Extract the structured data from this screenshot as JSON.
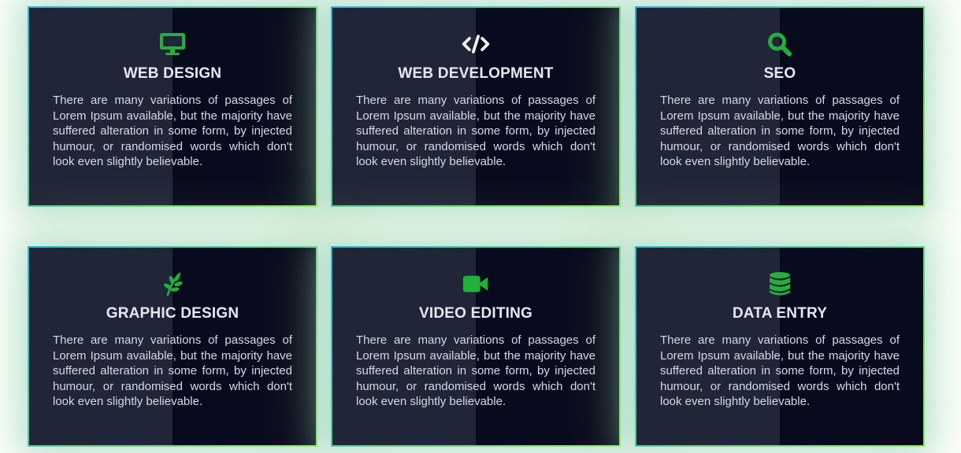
{
  "colors": {
    "accent": "#22b03a",
    "code_icon": "#f2f2f2",
    "card_left": "#202538",
    "card_right": "#080b1e",
    "border_from": "#27b4cf",
    "border_to": "#8fe84f"
  },
  "cards": [
    {
      "title": "WEB DESIGN",
      "icon": "monitor-icon",
      "text": "There are many variations of passages of Lorem Ipsum available, but the majority have suffered alteration in some form, by injected humour, or randomised words which don't look even slightly believable."
    },
    {
      "title": "WEB DEVELOPMENT",
      "icon": "code-icon",
      "text": "There are many variations of passages of Lorem Ipsum available, but the majority have suffered alteration in some form, by injected humour, or randomised words which don't look even slightly believable."
    },
    {
      "title": "SEO",
      "icon": "search-icon",
      "text": "There are many variations of passages of Lorem Ipsum available, but the majority have suffered alteration in some form, by injected humour, or randomised words which don't look even slightly believable."
    },
    {
      "title": "GRAPHIC DESIGN",
      "icon": "leaf-icon",
      "text": "There are many variations of passages of Lorem Ipsum available, but the majority have suffered alteration in some form, by injected humour, or randomised words which don't look even slightly believable."
    },
    {
      "title": "VIDEO EDITING",
      "icon": "video-camera-icon",
      "text": "There are many variations of passages of Lorem Ipsum available, but the majority have suffered alteration in some form, by injected humour, or randomised words which don't look even slightly believable."
    },
    {
      "title": "DATA ENTRY",
      "icon": "database-icon",
      "text": "There are many variations of passages of Lorem Ipsum available, but the majority have suffered alteration in some form, by injected humour, or randomised words which don't look even slightly believable."
    }
  ]
}
